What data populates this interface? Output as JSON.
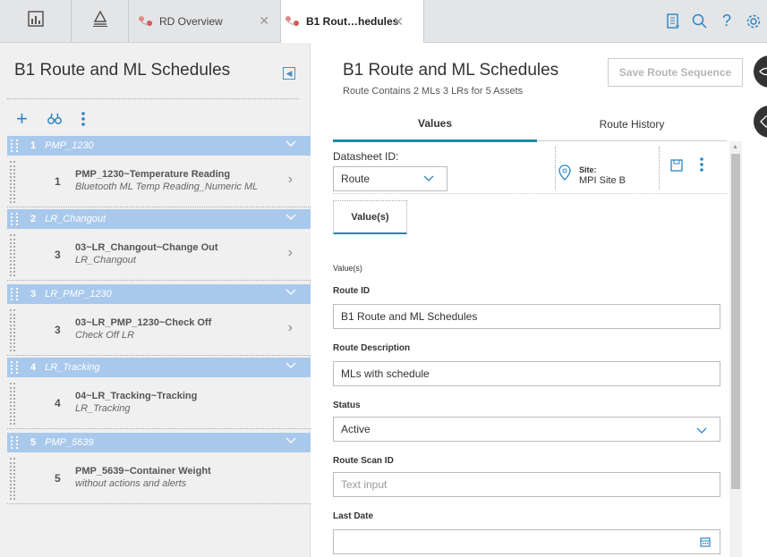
{
  "tabs": [
    {
      "label": "RD Overview",
      "icon": "route-icon"
    },
    {
      "label": "B1 Rout…hedules",
      "icon": "route-icon"
    }
  ],
  "left": {
    "title": "B1 Route and ML Schedules",
    "groups": [
      {
        "num": "1",
        "name": "PMP_1230",
        "item_num": "1",
        "item_title": "PMP_1230~Temperature Reading",
        "item_sub": "Bluetooth ML Temp Reading_Numeric ML"
      },
      {
        "num": "2",
        "name": "LR_Changout",
        "item_num": "3",
        "item_title": "03~LR_Changout~Change Out",
        "item_sub": "LR_Changout"
      },
      {
        "num": "3",
        "name": "LR_PMP_1230",
        "item_num": "3",
        "item_title": "03~LR_PMP_1230~Check Off",
        "item_sub": "Check Off LR"
      },
      {
        "num": "4",
        "name": "LR_Tracking",
        "item_num": "4",
        "item_title": "04~LR_Tracking~Tracking",
        "item_sub": "LR_Tracking"
      },
      {
        "num": "5",
        "name": "PMP_5639",
        "item_num": "5",
        "item_title": "PMP_5639~Container Weight",
        "item_sub": "without actions and alerts"
      }
    ]
  },
  "right": {
    "title": "B1 Route and ML Schedules",
    "subtitle": "Route Contains 2 MLs 3 LRs for 5 Assets",
    "save_label": "Save Route Sequence",
    "tab_values": "Values",
    "tab_history": "Route History",
    "datasheet_label": "Datasheet ID:",
    "datasheet_value": "Route",
    "site_label": "Site:",
    "site_value": "MPI Site B",
    "subtab": "Value(s)",
    "section_label": "Value(s)",
    "fields": {
      "route_id_label": "Route ID",
      "route_id_value": "B1 Route and ML Schedules",
      "route_desc_label": "Route Description",
      "route_desc_value": "MLs with schedule",
      "status_label": "Status",
      "status_value": "Active",
      "scan_label": "Route Scan ID",
      "scan_placeholder": "Text input",
      "last_date_label": "Last Date",
      "last_date_value": ""
    }
  },
  "colors": {
    "accent": "#1d8aa6",
    "group_header": "#a9c9ec",
    "link": "#2a86c6"
  }
}
